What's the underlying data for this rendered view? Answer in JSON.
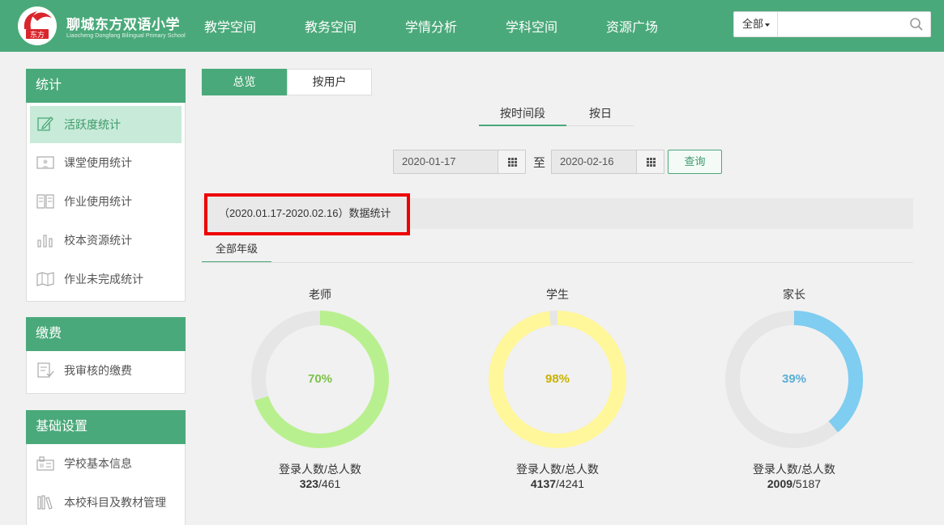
{
  "header": {
    "logo_text": "东方",
    "school_name": "聊城东方双语小学",
    "school_name_en": "Liaocheng Dongfang Bilingual Primary School",
    "nav": [
      "教学空间",
      "教务空间",
      "学情分析",
      "学科空间",
      "资源广场"
    ],
    "search": {
      "scope": "全部",
      "placeholder": ""
    }
  },
  "sidebar": {
    "stats": {
      "title": "统计",
      "items": [
        {
          "label": "活跃度统计",
          "icon": "edit-icon",
          "active": true
        },
        {
          "label": "课堂使用统计",
          "icon": "classroom-icon"
        },
        {
          "label": "作业使用统计",
          "icon": "homework-icon"
        },
        {
          "label": "校本资源统计",
          "icon": "bar-chart-icon"
        },
        {
          "label": "作业未完成统计",
          "icon": "map-icon"
        }
      ]
    },
    "fees": {
      "title": "缴费",
      "items": [
        {
          "label": "我审核的缴费",
          "icon": "document-check-icon"
        }
      ]
    },
    "settings": {
      "title": "基础设置",
      "items": [
        {
          "label": "学校基本信息",
          "icon": "school-info-icon"
        },
        {
          "label": "本校科目及教材管理",
          "icon": "books-icon"
        }
      ]
    }
  },
  "main": {
    "view_tabs": [
      "总览",
      "按用户"
    ],
    "range_tabs": [
      "按时间段",
      "按日"
    ],
    "date_from": "2020-01-17",
    "date_to": "2020-02-16",
    "to_label": "至",
    "query_label": "查询",
    "stat_label": "（2020.01.17-2020.02.16）数据统计",
    "grade_tab": "全部年级",
    "caption": "登录人数/总人数",
    "cards": [
      {
        "title": "老师",
        "pct_text": "70%",
        "pct": 0.7,
        "logged": "323",
        "total": "/461",
        "color": "#b9f08f",
        "text_color": "#7cc24a"
      },
      {
        "title": "学生",
        "pct_text": "98%",
        "pct": 0.98,
        "logged": "4137",
        "total": "/4241",
        "color": "#fff79a",
        "text_color": "#c9b200"
      },
      {
        "title": "家长",
        "pct_text": "39%",
        "pct": 0.39,
        "logged": "2009",
        "total": "/5187",
        "color": "#7fcdf0",
        "text_color": "#5aaed6"
      }
    ],
    "ring_bg": "#e6e6e6"
  }
}
